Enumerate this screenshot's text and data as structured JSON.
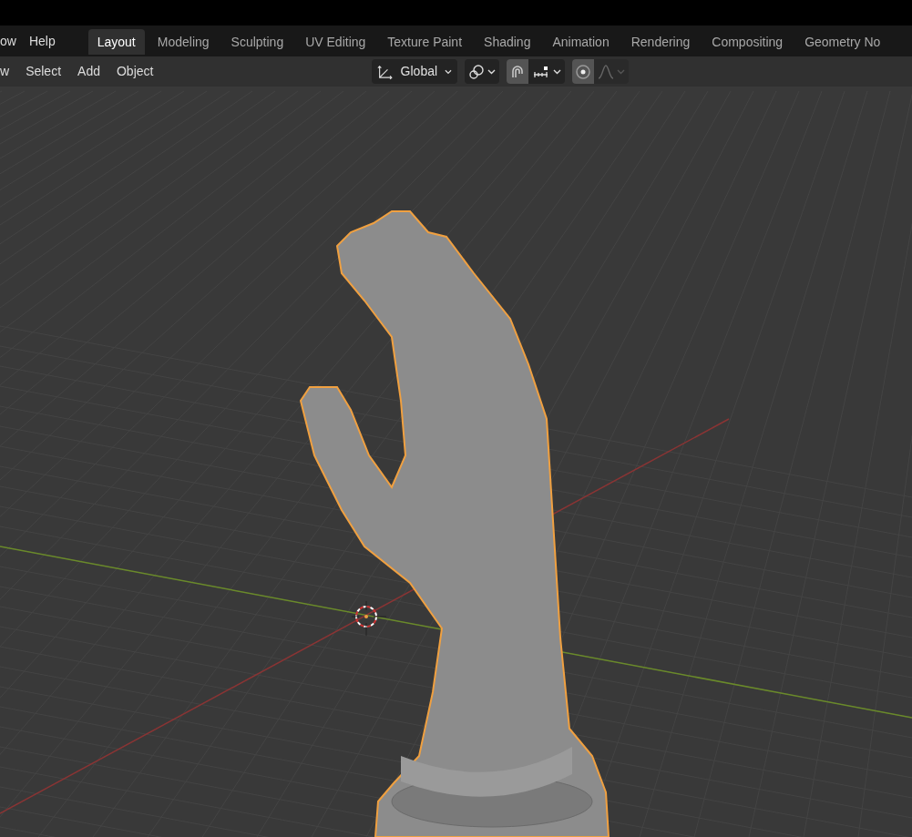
{
  "top_menu": [
    "ow",
    "Help"
  ],
  "workspace_tabs": [
    {
      "label": "Layout",
      "selected": true
    },
    {
      "label": "Modeling",
      "selected": false
    },
    {
      "label": "Sculpting",
      "selected": false
    },
    {
      "label": "UV Editing",
      "selected": false
    },
    {
      "label": "Texture Paint",
      "selected": false
    },
    {
      "label": "Shading",
      "selected": false
    },
    {
      "label": "Animation",
      "selected": false
    },
    {
      "label": "Rendering",
      "selected": false
    },
    {
      "label": "Compositing",
      "selected": false
    },
    {
      "label": "Geometry No",
      "selected": false
    }
  ],
  "viewport_header": {
    "menus": [
      "w",
      "Select",
      "Add",
      "Object"
    ],
    "transform_orientation": "Global",
    "snapping": {
      "on": true
    },
    "proportional_editing": {
      "on": true
    }
  }
}
